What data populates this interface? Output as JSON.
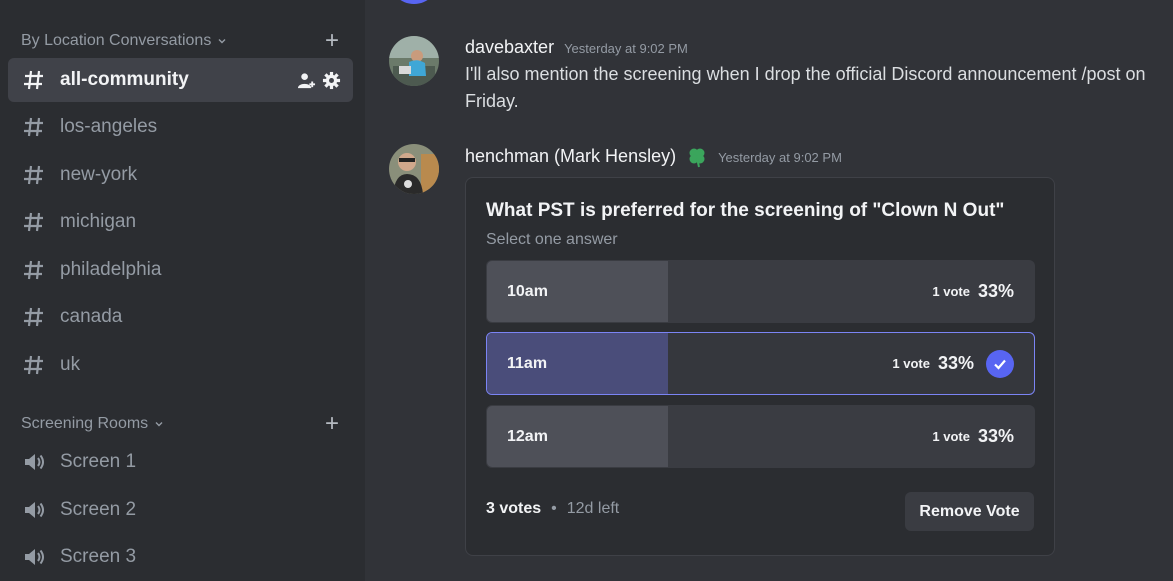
{
  "sidebar": {
    "categories": [
      {
        "label": "By Location Conversations"
      },
      {
        "label": "Screening Rooms"
      }
    ],
    "text_channels": [
      {
        "label": "all-community",
        "active": true
      },
      {
        "label": "los-angeles"
      },
      {
        "label": "new-york"
      },
      {
        "label": "michigan"
      },
      {
        "label": "philadelphia"
      },
      {
        "label": "canada"
      },
      {
        "label": "uk"
      }
    ],
    "voice_channels": [
      {
        "label": "Screen 1"
      },
      {
        "label": "Screen 2"
      },
      {
        "label": "Screen 3"
      }
    ]
  },
  "messages": [
    {
      "username": "davebaxter",
      "timestamp": "Yesterday at 9:02 PM",
      "text": "I'll also mention the screening when I drop the official Discord announcement /post on Friday."
    },
    {
      "username": "henchman (Mark Hensley)",
      "timestamp": "Yesterday at 9:02 PM",
      "badge_icon": "clover-icon"
    }
  ],
  "poll": {
    "question": "What PST is preferred for the screening of \"Clown N Out\"",
    "subtitle": "Select one answer",
    "answers": [
      {
        "label": "10am",
        "votes": "1 vote",
        "percent": "33%",
        "fraction": 0.33,
        "selected": false
      },
      {
        "label": "11am",
        "votes": "1 vote",
        "percent": "33%",
        "fraction": 0.33,
        "selected": true
      },
      {
        "label": "12am",
        "votes": "1 vote",
        "percent": "33%",
        "fraction": 0.33,
        "selected": false
      }
    ],
    "total_votes": "3 votes",
    "separator": "•",
    "time_left": "12d left",
    "remove_vote_label": "Remove Vote"
  },
  "colors": {
    "accent": "#5865f2",
    "background": "#313338",
    "sidebar": "#2b2d31"
  }
}
